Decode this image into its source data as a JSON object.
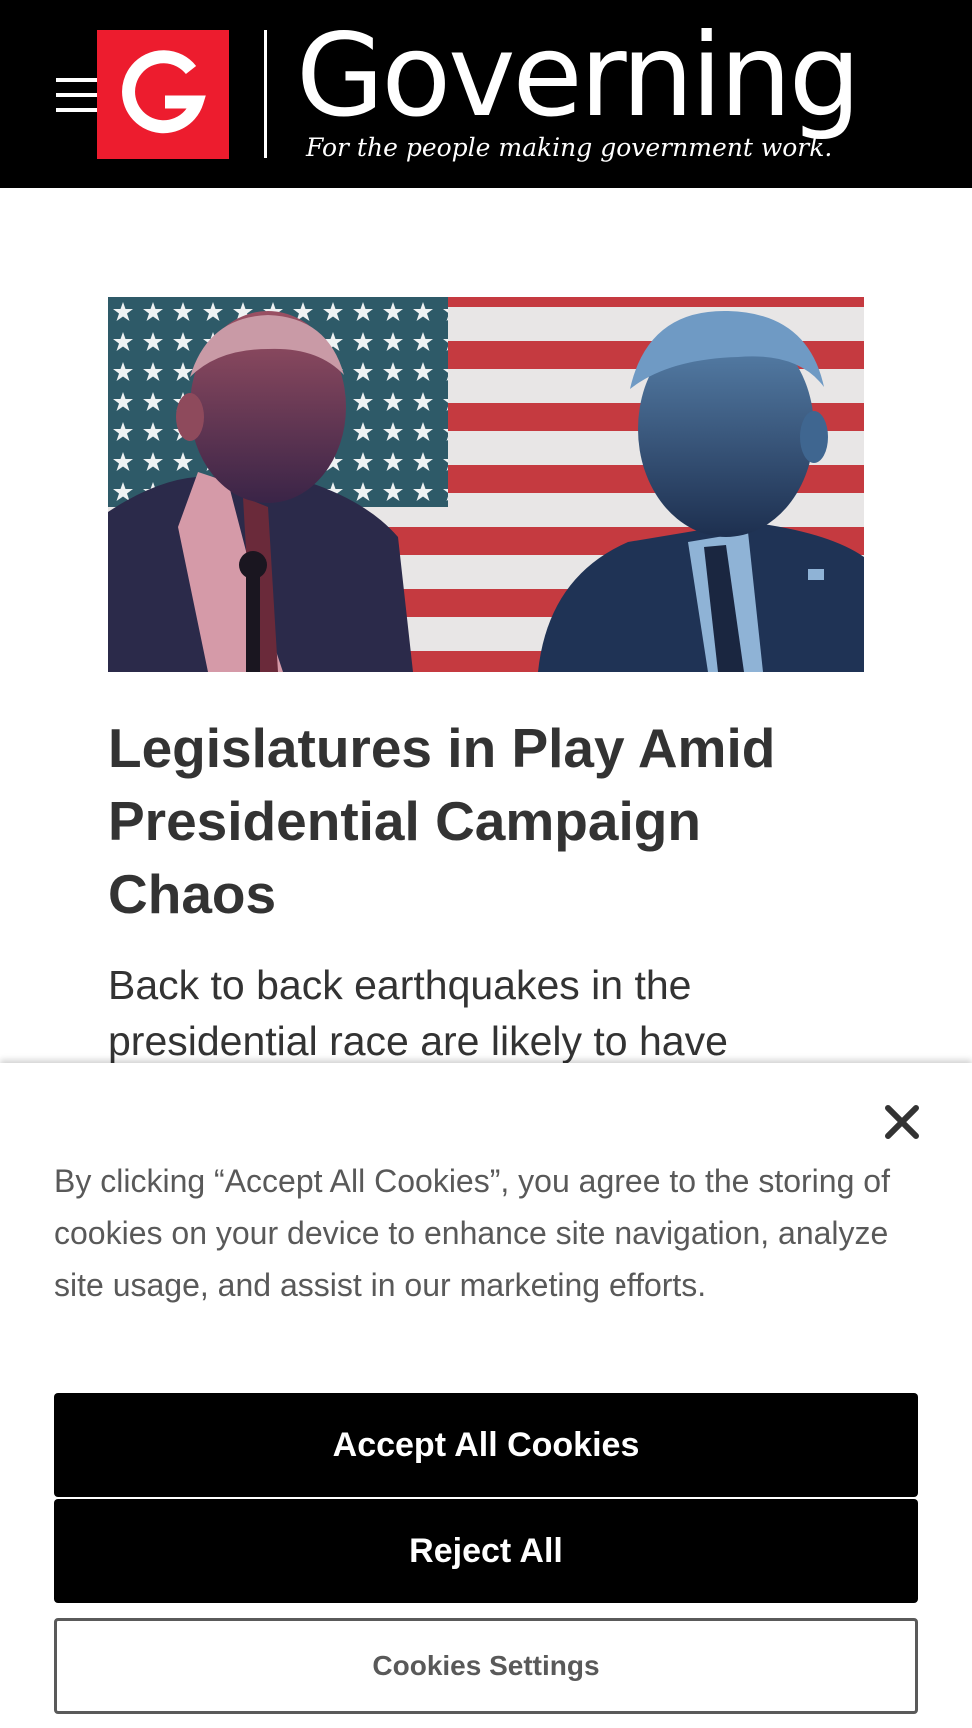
{
  "header": {
    "logo_letter": "G",
    "wordmark": "Governing",
    "tagline": "For the people making government work."
  },
  "article": {
    "headline": "Legislatures in Play Amid Presidential Campaign Chaos",
    "dek": "Back to back earthquakes in the presidential race are likely to have"
  },
  "cookie_banner": {
    "text": "By clicking “Accept All Cookies”, you agree to the storing of cookies on your device to enhance site navigation, analyze site usage, and assist in our marketing efforts.",
    "accept_label": "Accept All Cookies",
    "reject_label": "Reject All",
    "settings_label": "Cookies Settings"
  },
  "icons": {
    "menu": "hamburger-menu-icon",
    "close": "close-icon"
  },
  "colors": {
    "brand_red": "#ed1c2e",
    "header_bg": "#000000",
    "button_bg": "#000000",
    "text": "#333333"
  }
}
